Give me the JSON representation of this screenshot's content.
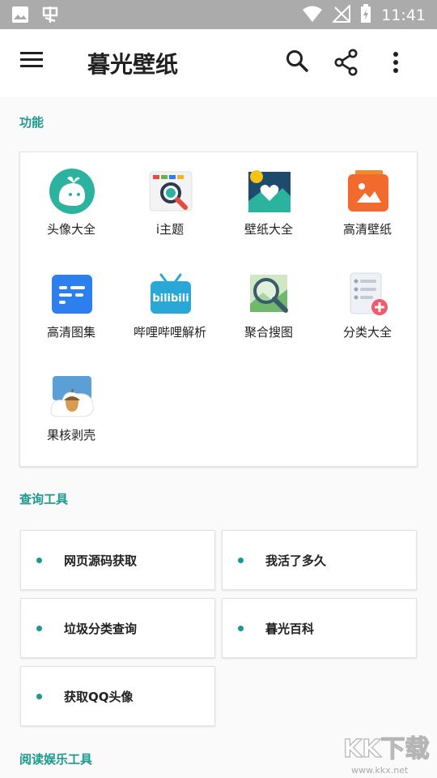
{
  "status_bar": {
    "time": "11:41",
    "left_icons": [
      "image-icon",
      "bug-icon"
    ],
    "right_icons": [
      "wifi-icon",
      "no-signal-icon",
      "battery-icon"
    ]
  },
  "app_bar": {
    "title": "暮光壁纸",
    "icons": [
      "menu-icon",
      "search-icon",
      "share-icon",
      "more-vert-icon"
    ]
  },
  "sections": {
    "features_title": "功能",
    "query_title": "查询工具",
    "reading_title": "阅读娱乐工具"
  },
  "features": [
    {
      "label": "头像大全",
      "icon": "avatar-icon",
      "color": "#2bb3a0"
    },
    {
      "label": "i主题",
      "icon": "theme-search-icon",
      "color": "#e94a3f"
    },
    {
      "label": "壁纸大全",
      "icon": "wallpaper-heart-icon",
      "color": "#1e4a6b"
    },
    {
      "label": "高清壁纸",
      "icon": "hd-wallpaper-icon",
      "color": "#f26a2e"
    },
    {
      "label": "高清图集",
      "icon": "gallery-icon",
      "color": "#2d7ff0"
    },
    {
      "label": "哔哩哔哩解析",
      "icon": "bilibili-icon",
      "color": "#29a7d6"
    },
    {
      "label": "聚合搜图",
      "icon": "image-search-icon",
      "color": "#6fb86c"
    },
    {
      "label": "分类大全",
      "icon": "category-list-icon",
      "color": "#ef5b6b"
    },
    {
      "label": "果核剥壳",
      "icon": "acorn-icon",
      "color": "#8a5a2b"
    }
  ],
  "query_tools": [
    {
      "label": "网页源码获取"
    },
    {
      "label": "我活了多久"
    },
    {
      "label": "垃圾分类查询"
    },
    {
      "label": "暮光百科"
    },
    {
      "label": "获取QQ头像"
    }
  ],
  "watermark": {
    "text": "KK下载",
    "url": "www.kkx.net"
  },
  "colors": {
    "accent": "#1a9a8e",
    "status_bar": "#ababab"
  }
}
